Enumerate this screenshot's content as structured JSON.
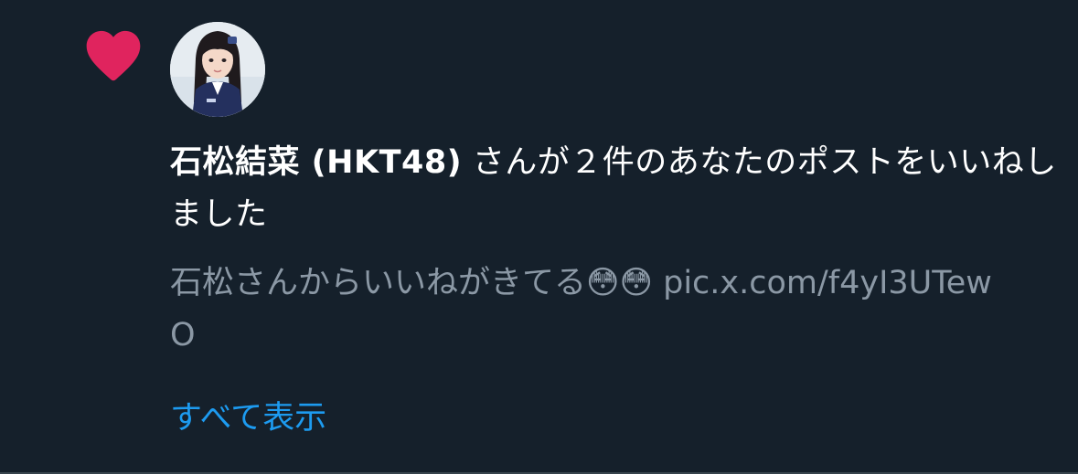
{
  "notification": {
    "icon": "heart-icon",
    "icon_color": "#e0245e",
    "user_name": "石松結菜 (HKT48)",
    "action_text": " さんが２件のあなたのポストをいいねしました",
    "preview_text": "石松さんからいいねがきてる😳😳 pic.x.com/f4yI3UTewO",
    "show_all_label": "すべて表示"
  },
  "colors": {
    "background": "#15202b",
    "primary_text": "#ffffff",
    "secondary_text": "#8b98a5",
    "link": "#1d9bf0"
  }
}
